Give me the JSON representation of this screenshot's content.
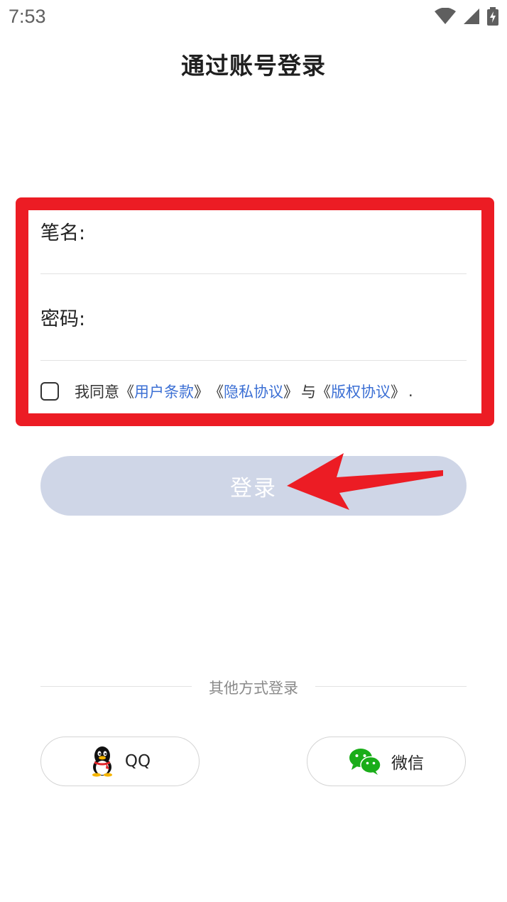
{
  "status_bar": {
    "time": "7:53",
    "icons": [
      "wifi-icon",
      "cellular-signal-icon",
      "battery-charging-icon"
    ]
  },
  "header": {
    "title": "通过账号登录"
  },
  "form": {
    "pen_name_label": "笔名:",
    "pen_name_value": "",
    "password_label": "密码:",
    "password_value": "",
    "agreement": {
      "checked": false,
      "prefix": "我同意",
      "bracket_open": "《",
      "bracket_close": "》",
      "terms_link": "用户条款",
      "privacy_link": "隐私协议",
      "conjunction": "与",
      "copyright_link": "版权协议",
      "suffix": "."
    }
  },
  "login_button": {
    "label": "登录"
  },
  "other_login": {
    "label": "其他方式登录",
    "qq_label": "QQ",
    "wechat_label": "微信"
  },
  "colors": {
    "highlight": "#ec1c24",
    "button_bg": "#cfd6e7",
    "link": "#3b6fd4",
    "wechat_green": "#1aad19"
  }
}
